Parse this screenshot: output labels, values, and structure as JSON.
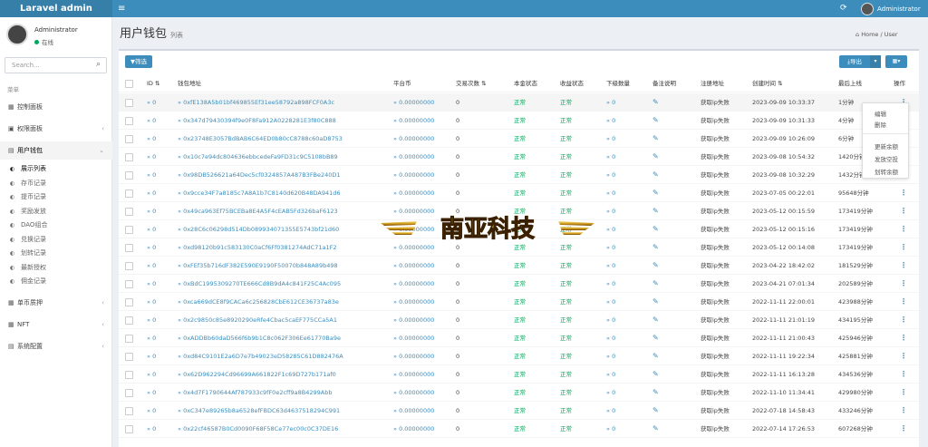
{
  "topbar": {
    "logo": "Laravel admin",
    "menu_icon": "≡",
    "refresh_icon": "⟳",
    "username": "Administrator"
  },
  "sidebar": {
    "user": {
      "name": "Administrator",
      "status": "在线"
    },
    "search_placeholder": "Search...",
    "header": "菜单",
    "items": [
      {
        "label": "控制面板",
        "icon": "▦"
      },
      {
        "label": "权限面板",
        "icon": "▣"
      },
      {
        "label": "用户钱包",
        "icon": "▤"
      },
      {
        "label": "单币质押",
        "icon": "▦"
      },
      {
        "label": "NFT",
        "icon": "▦"
      },
      {
        "label": "系统配置",
        "icon": "▤"
      }
    ],
    "subitems": [
      "展示列表",
      "存币记录",
      "提币记录",
      "奖励发放",
      "DAO组合",
      "兑换记录",
      "划转记录",
      "最新授权",
      "佣金记录"
    ]
  },
  "page": {
    "title": "用户钱包",
    "subtitle": "列表",
    "breadcrumb_home": "Home",
    "breadcrumb_sep": "/",
    "breadcrumb_current": "User"
  },
  "toolbar": {
    "filter": "筛选",
    "export": "导出",
    "columns": "▦"
  },
  "table": {
    "headers": [
      "ID",
      "钱包地址",
      "平台币",
      "交易次数",
      "本金状态",
      "收益状态",
      "下级数量",
      "备注说明",
      "注册地址",
      "创建时间",
      "最后上线",
      "操作"
    ],
    "rows": [
      {
        "id": "0",
        "address": "0xfE138A5b01bf469855Ef31ee58792a898FCF0A3c",
        "coin": "0.00000000",
        "tx": "0",
        "principal": "正常",
        "income": "正常",
        "sub": "0",
        "reg": "获取ip失败",
        "created": "2023-09-09 10:33:37",
        "last": "1分钟"
      },
      {
        "id": "0",
        "address": "0x347d79430394f9e0F8Fa912A0228281E3f80C888",
        "coin": "0.00000000",
        "tx": "0",
        "principal": "正常",
        "income": "正常",
        "sub": "0",
        "reg": "获取ip失败",
        "created": "2023-09-09 10:31:33",
        "last": "4分钟"
      },
      {
        "id": "0",
        "address": "0x23748E3057BdBAB6C64ED0b80cC8788c60aD8753",
        "coin": "0.00000000",
        "tx": "0",
        "principal": "正常",
        "income": "正常",
        "sub": "0",
        "reg": "获取ip失败",
        "created": "2023-09-09 10:26:09",
        "last": "6分钟"
      },
      {
        "id": "0",
        "address": "0x10c7e94dc804636ebbcedeFa9FD31c9C5108bB89",
        "coin": "0.00000000",
        "tx": "0",
        "principal": "正常",
        "income": "正常",
        "sub": "0",
        "reg": "获取ip失败",
        "created": "2023-09-08 10:54:32",
        "last": "1420分钟"
      },
      {
        "id": "0",
        "address": "0x98DB526621a64Dec5cf0324857A487B3FBe240D1",
        "coin": "0.00000000",
        "tx": "0",
        "principal": "正常",
        "income": "正常",
        "sub": "0",
        "reg": "获取ip失败",
        "created": "2023-09-08 10:32:29",
        "last": "1432分钟"
      },
      {
        "id": "0",
        "address": "0x9cce34F7a8185c7A8A1b7C8140d620B48DA941d6",
        "coin": "0.00000000",
        "tx": "0",
        "principal": "正常",
        "income": "正常",
        "sub": "0",
        "reg": "获取ip失败",
        "created": "2023-07-05 00:22:01",
        "last": "95648分钟"
      },
      {
        "id": "0",
        "address": "0x49ca963Ef75BCEBa8E4A5F4cEAB5Fd326baF6123",
        "coin": "0.00000000",
        "tx": "0",
        "principal": "正常",
        "income": "正常",
        "sub": "0",
        "reg": "获取ip失败",
        "created": "2023-05-12 00:15:59",
        "last": "173419分钟"
      },
      {
        "id": "0",
        "address": "0x28C6c06298d514Db089934071355E5743bf21d60",
        "coin": "0.00000000",
        "tx": "0",
        "principal": "正常",
        "income": "正常",
        "sub": "0",
        "reg": "获取ip失败",
        "created": "2023-05-12 00:15:16",
        "last": "173419分钟"
      },
      {
        "id": "0",
        "address": "0xd98120b91c583130C0aCf6Ff0381274AdC71a1F2",
        "coin": "0.00000000",
        "tx": "0",
        "principal": "正常",
        "income": "正常",
        "sub": "0",
        "reg": "获取ip失败",
        "created": "2023-05-12 00:14:08",
        "last": "173419分钟"
      },
      {
        "id": "0",
        "address": "0xFEf35b716dF382E590E9190F50070b848A89b498",
        "coin": "0.00000000",
        "tx": "0",
        "principal": "正常",
        "income": "正常",
        "sub": "0",
        "reg": "获取ip失败",
        "created": "2023-04-22 18:42:02",
        "last": "181529分钟"
      },
      {
        "id": "0",
        "address": "0xBdC1995309270TE666Cd8B9dA4c841F25C4Ac095",
        "coin": "0.00000000",
        "tx": "0",
        "principal": "正常",
        "income": "正常",
        "sub": "0",
        "reg": "获取ip失败",
        "created": "2023-04-21 07:01:34",
        "last": "202589分钟"
      },
      {
        "id": "0",
        "address": "0xca669dCE8f9CACa6c256828CbE612CE36737a83e",
        "coin": "0.00000000",
        "tx": "0",
        "principal": "正常",
        "income": "正常",
        "sub": "0",
        "reg": "获取ip失败",
        "created": "2022-11-11 22:00:01",
        "last": "423988分钟"
      },
      {
        "id": "0",
        "address": "0x2c9850c85e8920290eRfe4Cbac5caEF775CCa5A1",
        "coin": "0.00000000",
        "tx": "0",
        "principal": "正常",
        "income": "正常",
        "sub": "0",
        "reg": "获取ip失败",
        "created": "2022-11-11 21:01:19",
        "last": "434195分钟"
      },
      {
        "id": "0",
        "address": "0xADDBb60daD566f6b9b1C8c062F306Ee61770Ba9e",
        "coin": "0.00000000",
        "tx": "0",
        "principal": "正常",
        "income": "正常",
        "sub": "0",
        "reg": "获取ip失败",
        "created": "2022-11-11 21:00:43",
        "last": "425946分钟"
      },
      {
        "id": "0",
        "address": "0xd84C9101E2a6D7e7b49023eD58285C61D882476A",
        "coin": "0.00000000",
        "tx": "0",
        "principal": "正常",
        "income": "正常",
        "sub": "0",
        "reg": "获取ip失败",
        "created": "2022-11-11 19:22:34",
        "last": "425881分钟"
      },
      {
        "id": "0",
        "address": "0x62D962294Cd96699A661822F1c69D727b171af0",
        "coin": "0.00000000",
        "tx": "0",
        "principal": "正常",
        "income": "正常",
        "sub": "0",
        "reg": "获取ip失败",
        "created": "2022-11-11 16:13:28",
        "last": "434536分钟"
      },
      {
        "id": "0",
        "address": "0x4d7F1790644Af787933c9fF0e2cff9a8B4299Abb",
        "coin": "0.00000000",
        "tx": "0",
        "principal": "正常",
        "income": "正常",
        "sub": "0",
        "reg": "获取ip失败",
        "created": "2022-11-10 11:34:41",
        "last": "429980分钟"
      },
      {
        "id": "0",
        "address": "0xC347e89265b8a6528efFBDC63d4637518294C991",
        "coin": "0.00000000",
        "tx": "0",
        "principal": "正常",
        "income": "正常",
        "sub": "0",
        "reg": "获取ip失败",
        "created": "2022-07-18 14:58:43",
        "last": "433246分钟"
      },
      {
        "id": "0",
        "address": "0x22cf46587B0Cd0090F68F58Ce77ec00c0C37DE16",
        "coin": "0.00000000",
        "tx": "0",
        "principal": "正常",
        "income": "正常",
        "sub": "0",
        "reg": "获取ip失败",
        "created": "2022-07-14 17:26:53",
        "last": "607268分钟"
      }
    ]
  },
  "row_menu": {
    "items": [
      "编辑",
      "删除",
      "更新余额",
      "发放空投",
      "划转余额"
    ]
  },
  "watermark": {
    "text": "南亚科技"
  }
}
